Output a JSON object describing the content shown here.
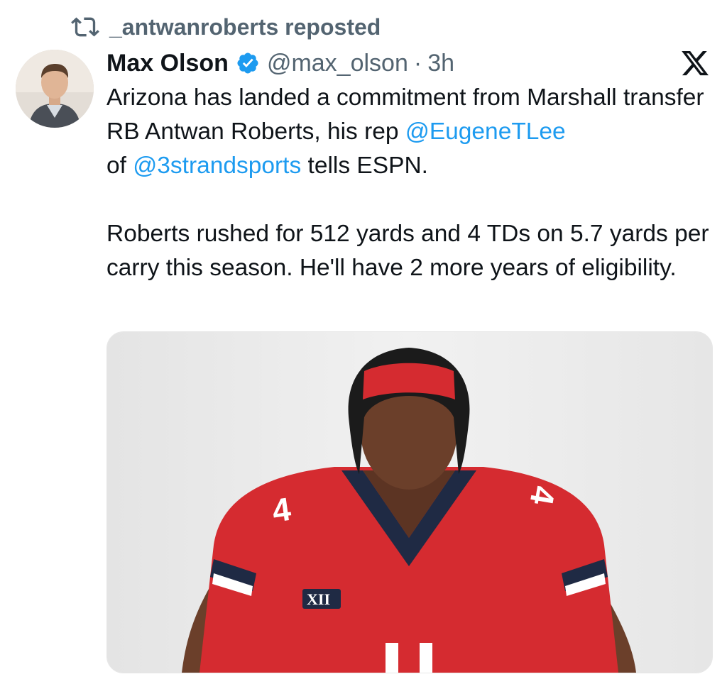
{
  "repost": {
    "icon": "repost-icon",
    "text": "_antwanroberts reposted"
  },
  "author": {
    "name": "Max Olson",
    "verified_icon": "verified-badge-icon",
    "handle": "@max_olson",
    "separator": "·",
    "time": "3h"
  },
  "platform_icon": "x-logo-icon",
  "tweet": {
    "p1_a": "Arizona has landed a commitment from Marshall transfer RB Antwan Roberts, his rep ",
    "mention1": "@EugeneTLee",
    "p1_b": " of ",
    "mention2": "@3strandsports",
    "p1_c": " tells ESPN.",
    "p2": "Roberts rushed for 512 yards and 4 TDs on 5.7 yards per carry this season. He'll have 2 more years of eligibility."
  },
  "media": {
    "jersey_number": "4",
    "patch": "XII"
  },
  "colors": {
    "mention": "#1d9bf0",
    "muted": "#536471",
    "verified": "#1d9bf0",
    "jersey_red": "#d52b30",
    "jersey_navy": "#1f2a44"
  }
}
